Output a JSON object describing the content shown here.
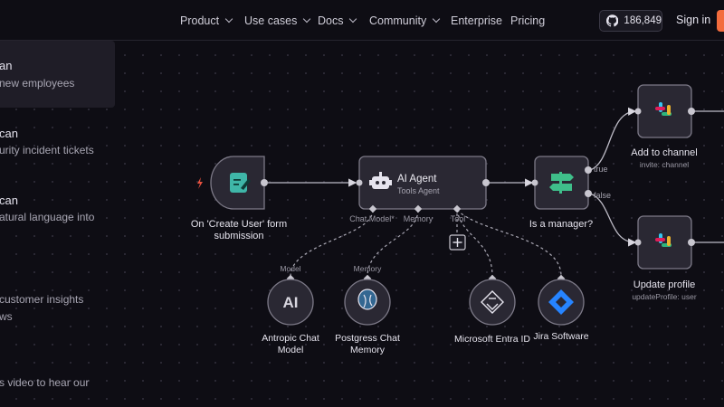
{
  "nav": {
    "items": [
      {
        "label": "Product",
        "dropdown": true
      },
      {
        "label": "Use cases",
        "dropdown": true
      },
      {
        "label": "Docs",
        "dropdown": true
      },
      {
        "label": "Community",
        "dropdown": true
      },
      {
        "label": "Enterprise",
        "dropdown": false
      },
      {
        "label": "Pricing",
        "dropdown": false
      }
    ],
    "github_stars": "186,849",
    "signin": "Sign in"
  },
  "use_cases": [
    {
      "title": "an",
      "subtitle": "new employees"
    },
    {
      "title": "can",
      "subtitle": "urity incident tickets"
    },
    {
      "title": "can",
      "subtitle": "atural language into"
    },
    {
      "title": "",
      "subtitle": "customer insights"
    },
    {
      "title": "",
      "subtitle": "ws"
    },
    {
      "title": "",
      "subtitle": "s video to hear our"
    }
  ],
  "workflow": {
    "trigger": {
      "label_line1": "On 'Create User' form",
      "label_line2": "submission"
    },
    "agent": {
      "title": "AI Agent",
      "subtitle": "Tools Agent",
      "ports": [
        "Chat Model*",
        "Memory",
        "Tool"
      ]
    },
    "if_node": {
      "label": "Is a manager?",
      "true_label": "true",
      "false_label": "false"
    },
    "slack_add": {
      "label": "Add to channel",
      "sub": "invite: channel"
    },
    "slack_update": {
      "label": "Update profile",
      "sub": "updateProfile: user"
    },
    "chat_model": {
      "port_label": "Model",
      "label_line1": "Antropic Chat",
      "label_line2": "Model",
      "glyph": "AI"
    },
    "memory": {
      "port_label": "Memory",
      "label_line1": "Postgress Chat",
      "label_line2": "Memory"
    },
    "entra": {
      "label": "Microsoft Entra ID"
    },
    "jira": {
      "label": "Jira Software"
    }
  },
  "colors": {
    "accent_orange": "#f36c3d",
    "trigger_teal": "#3fb6a8",
    "if_green": "#3fbf8a",
    "node_bg": "#2a2833",
    "node_border": "#7d7a88",
    "jira_blue": "#2684ff",
    "postgres_blue": "#336791"
  }
}
